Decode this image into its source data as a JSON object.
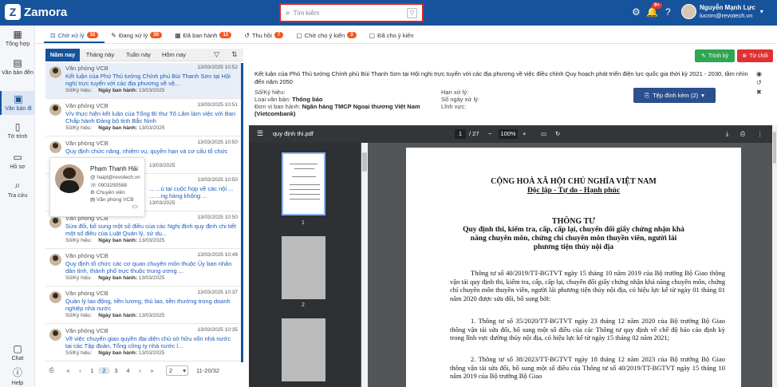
{
  "app": {
    "name": "Zamora"
  },
  "search": {
    "placeholder": "Tìm kiếm"
  },
  "notifications": {
    "count": "9+"
  },
  "user": {
    "name": "Nguyễn Mạnh Lực",
    "email": "lucnm@revotech.vn"
  },
  "sidebar": {
    "items": [
      {
        "label": "Tổng hợp",
        "icon": "grid-icon"
      },
      {
        "label": "Văn bản đến",
        "icon": "inbox-icon"
      },
      {
        "label": "Văn bản đi",
        "icon": "outbox-icon"
      },
      {
        "label": "Tờ trình",
        "icon": "document-icon"
      },
      {
        "label": "Hồ sơ",
        "icon": "folder-icon"
      },
      {
        "label": "Tra cứu",
        "icon": "search-icon"
      },
      {
        "label": "Chat",
        "icon": "chat-icon"
      },
      {
        "label": "Help",
        "icon": "help-icon"
      }
    ]
  },
  "tabs": [
    {
      "label": "Chờ xử lý",
      "count": "32"
    },
    {
      "label": "Đang xử lý",
      "count": "30"
    },
    {
      "label": "Đã ban hành",
      "count": "12"
    },
    {
      "label": "Thu hồi",
      "count": "7"
    },
    {
      "label": "Chờ cho ý kiến",
      "count": "3"
    },
    {
      "label": "Đã cho ý kiến",
      "count": ""
    }
  ],
  "filters": {
    "tabs": [
      "Năm nay",
      "Tháng này",
      "Tuần này",
      "Hôm nay"
    ]
  },
  "documents": [
    {
      "org": "Văn phòng VCB",
      "time": "13/03/2025 10:52",
      "title": "Kết luận của Phó Thủ tướng Chính phủ Bùi Thanh Sơn tại Hội nghị trực tuyến với các địa phương về vệ...",
      "meta_label": "Số/Ký hiệu:",
      "date_label": "Ngày ban hành:",
      "date": "13/03/2025"
    },
    {
      "org": "Văn phòng VCB",
      "time": "13/03/2025 10:51",
      "title": "V/v thực hiện kết luận của Tổng Bí thư Tô Lâm làm việc với Ban Chấp hành Đảng bộ tỉnh Bắc Ninh",
      "meta_label": "Số/Ký hiệu:",
      "date_label": "Ngày ban hành:",
      "date": "13/03/2025"
    },
    {
      "org": "Văn phòng VCB",
      "time": "13/03/2025 10:50",
      "title": "Quy định chức năng, nhiệm vụ, quyền hạn và cơ cấu tổ chức",
      "meta_label": "",
      "date_label": "",
      "date": "13/03/2025"
    },
    {
      "org": "",
      "time": "13/03/2025 10:50",
      "title": "... ...ủ tại cuộc họp về các nội ... ... ...ng hàng không ...",
      "meta_label": "",
      "date_label": "",
      "date": "13/03/2025"
    },
    {
      "org": "Văn phòng VCB",
      "time": "13/03/2025 10:50",
      "title": "Sửa đổi, bổ sung một số điều của các Nghị định quy định chi tiết một số điều của Luật Quản lý, sử dụ...",
      "meta_label": "Số/Ký hiệu:",
      "date_label": "Ngày ban hành:",
      "date": "13/03/2025"
    },
    {
      "org": "Văn phòng VCB",
      "time": "13/03/2025 10:49",
      "title": "Quy định tổ chức các cơ quan chuyên môn thuộc Ủy ban nhân dân tỉnh, thành phố trực thuộc trung ương ...",
      "meta_label": "Số/Ký hiệu:",
      "date_label": "Ngày ban hành:",
      "date": "13/03/2025"
    },
    {
      "org": "Văn phòng VCB",
      "time": "13/03/2025 10:37",
      "title": "Quản lý lao động, tiền lương, thù lao, tiền thưởng trong doanh nghiệp nhà nước",
      "meta_label": "Số/Ký hiệu:",
      "date_label": "Ngày ban hành:",
      "date": "13/03/2025"
    },
    {
      "org": "Văn phòng VCB",
      "time": "13/03/2025 10:35",
      "title": "Về việc chuyển giao quyền đại diện chủ sở hữu vốn nhà nước tại các Tập đoàn, Tổng công ty nhà nước l...",
      "meta_label": "Số/Ký hiệu:",
      "date_label": "Ngày ban hành:",
      "date": "13/03/2025"
    }
  ],
  "profile_card": {
    "name": "Phạm Thanh Hải",
    "email": "haipt@revotech.vn",
    "phone": "0903290588",
    "role": "Chuyên viên",
    "unit": "Văn phòng VCB"
  },
  "pagination": {
    "pages": [
      "1",
      "2",
      "3",
      "4"
    ],
    "current": "2",
    "per_page": "2",
    "range": "11-20/32"
  },
  "detail": {
    "sign_label": "Trình ký",
    "reject_label": "Từ chối",
    "title": "Kết luận của Phó Thủ tướng Chính phủ Bùi Thanh Sơn tại Hội nghị trực tuyến với các địa phương về việc điều chỉnh Quy hoạch phát triển điện lực quốc gia thời kỳ 2021 - 2030, tầm nhìn đến năm 2050",
    "so_ky_hieu_label": "Số/Ký hiệu:",
    "loai_label": "Loại văn bản:",
    "loai_value": "Thông báo",
    "don_vi_label": "Đơn vị ban hành:",
    "don_vi_value": "Ngân hàng TMCP Ngoại thương Việt Nam (Vietcombank)",
    "han_xu_ly_label": "Hạn xử lý:",
    "so_ngay_label": "Số ngày xử lý:",
    "linh_vuc_label": "Lĩnh vực:",
    "attach_label": "Tệp đính kèm (2)"
  },
  "viewer": {
    "filename": "quy định thi.pdf",
    "page": "1",
    "total": "/ 27",
    "zoom": "100%",
    "thumb_labels": [
      "1",
      "2"
    ]
  },
  "pdf": {
    "h1": "CỘNG HOÀ XÃ HỘI CHỦ NGHĨA VIỆT NAM",
    "h2": "Độc lập - Tự do - Hạnh phúc",
    "h3": "THÔNG TƯ",
    "h4": "Quy định thi, kiểm tra, cấp, cấp lại, chuyển đổi giấy chứng nhận khả năng chuyên môn, chứng chỉ chuyên môn thuyền viên, người lái phương tiện thủy nội địa",
    "p1": "Thông tư số 40/2019/TT-BGTVT ngày 15 tháng 10 năm 2019 của Bộ trưởng Bộ Giao thông vận tải quy định thi, kiểm tra, cấp, cấp lại, chuyển đổi giấy chứng nhận khả năng chuyên môn, chứng chỉ chuyên môn thuyền viên, người lái phương tiện thủy nội địa, có hiệu lực kể từ ngày 01 tháng 01 năm 2020 được sửa đổi, bổ sung bởi:",
    "p2": "1. Thông tư số 35/2020/TT-BGTVT ngày 23 tháng 12 năm 2020 của Bộ trưởng Bộ Giao thông vận tải sửa đổi, bổ sung một số điều của các Thông tư quy định về chế độ báo cáo định kỳ trong lĩnh vực đường thủy nội địa, có hiệu lực kể từ ngày 15 tháng 02 năm 2021;",
    "p3": "2. Thông tư số 38/2023/TT-BGTVT ngày 18 tháng 12 năm 2023 của Bộ trưởng Bộ Giao thông vận tải sửa đổi, bổ sung một số điều của Thông tư số 40/2019/TT-BGTVT ngày 15 tháng 10 năm 2019 của Bộ trưởng Bộ Giao"
  }
}
